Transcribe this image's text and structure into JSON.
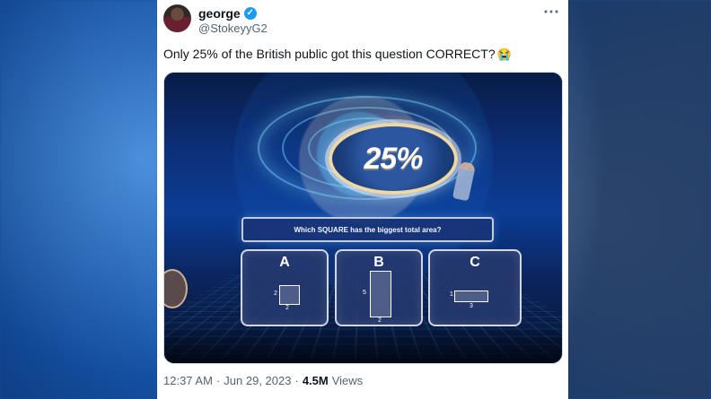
{
  "tweet": {
    "author": {
      "name": "george",
      "handle": "@StokeyyG2"
    },
    "text": "Only 25% of the British public got this question CORRECT?",
    "emoji": "😭",
    "media": {
      "percentage": "25%",
      "question": "Which SQUARE has the biggest total area?",
      "answers": [
        {
          "letter": "A",
          "left_dimension": "2",
          "bottom_dimension": "2"
        },
        {
          "letter": "B",
          "left_dimension": "5",
          "bottom_dimension": "2"
        },
        {
          "letter": "C",
          "left_dimension": "1",
          "bottom_dimension": "3"
        }
      ]
    },
    "meta": {
      "time": "12:37 AM",
      "separator_1": "·",
      "date": "Jun 29, 2023",
      "separator_2": "·",
      "views_count": "4.5M",
      "views_label": "Views"
    }
  },
  "icons": {
    "verified": "verified-badge-icon",
    "more": "more-options-icon"
  },
  "colors": {
    "tweet_text": "#0f1419",
    "muted_text": "#536471",
    "verified": "#1d9bf0"
  }
}
